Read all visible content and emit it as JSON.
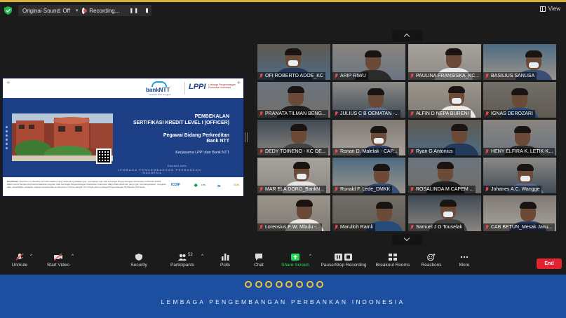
{
  "topbar": {
    "sound_label": "Original Sound: Off",
    "recording_label": "Recording...",
    "view_label": "View"
  },
  "slide": {
    "logo_bank": "bankNTT",
    "logo_bank_sub": "melayani lebih sungguh",
    "logo_lppi": "LPPI",
    "logo_lppi_sub": "Lembaga Pengembangan Perbankan Indonesia",
    "title_line1": "PEMBEKALAN",
    "title_line2": "SERTIFIKASI KREDIT LEVEL I (OFFICER)",
    "title_line3": "Pegawai Bidang Perkreditan",
    "title_line4": "Bank NTT",
    "title_line5": "Kerjasama LPPI dan Bank NTT",
    "org_line1": "Disusun oleh:",
    "org_line2": "LEMBAGA PENGEMBANGAN PERBANKAN",
    "org_line3": "INDONESIA",
    "disclaimer_label": "Disclaimer:",
    "disclaimer_text": "Dokumen ini (beserta informasi apapun yang terkandung didalamnya), merupakan hak milik Lembaga Pengembangan Perbankan Indonesia (LPPI) dalam hal ini berupa proposal penawaran program milik Lembaga Pengembangan Perbankan Indonesia. Bagi pihak-pihak lain yang ingin mempergunakan, mengutip, atau menerbitkan sebagian maupun keseluruhan isi dokumen ini harus dengan izin tertulis dari Lembaga Pengembangan Perbankan Indonesia.",
    "footer_logo1": "ICDIF",
    "footer_logo2": "LPS",
    "footer_logo3": "OJK"
  },
  "participants": [
    {
      "name": "OFI ROBERTO ADOE_KC",
      "muted": true
    },
    {
      "name": "ARIP RIWU",
      "muted": true
    },
    {
      "name": "PAULINA FRANSISKA_KC...",
      "muted": true
    },
    {
      "name": "BASILIUS SANUSA",
      "muted": true
    },
    {
      "name": "PRANATA TILMAN BENG...",
      "muted": true
    },
    {
      "name": "JULIUS C B OEMATAN -...",
      "muted": true
    },
    {
      "name": "ALFIN D NEPA BURENI",
      "muted": true
    },
    {
      "name": "IGNAS DEROZARI",
      "muted": true
    },
    {
      "name": "DEDY TOINENO - KC OE...",
      "muted": true
    },
    {
      "name": "Ronan D. Malelak - CAP...",
      "muted": true
    },
    {
      "name": "Ryan G Antonius",
      "muted": true
    },
    {
      "name": "HENY ELFIRA K. LETIK-K...",
      "muted": true
    },
    {
      "name": "MAR ELA DORO_BankN...",
      "muted": true
    },
    {
      "name": "Ronald F. Lede_DMKK",
      "muted": true
    },
    {
      "name": "ROSALINDA M CAPEM ...",
      "muted": true
    },
    {
      "name": "Johanes A.C. Wangge",
      "muted": true
    },
    {
      "name": "Lorensius E.W. Mbulu -...",
      "muted": true
    },
    {
      "name": "Marulloh Ramli",
      "muted": true
    },
    {
      "name": "Samuel J G Touselak",
      "muted": true
    },
    {
      "name": "CAB BETUN_Mesak Janu...",
      "muted": true
    }
  ],
  "toolbar": {
    "unmute": "Unmute",
    "start_video": "Start Video",
    "security": "Security",
    "participants": "Participants",
    "participants_count": "52",
    "polls": "Polls",
    "chat": "Chat",
    "share_screen": "Share Screen",
    "pause_recording": "Pause/Stop Recording",
    "breakout": "Breakout Rooms",
    "reactions": "Reactions",
    "more": "More",
    "end": "End"
  },
  "footer": {
    "text": "LEMBAGA PENGEMBANGAN PERBANKAN INDONESIA"
  },
  "colors": {
    "accent_gold": "#d7b23a",
    "footer_blue": "#1d4fa0",
    "end_red": "#e0232e",
    "share_green": "#23d959",
    "muted_red": "#e5484d"
  }
}
